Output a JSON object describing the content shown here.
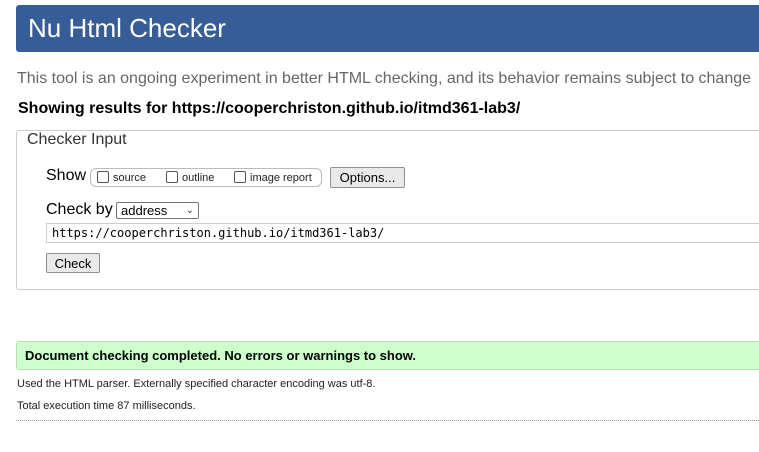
{
  "header": {
    "title": "Nu Html Checker",
    "color": "#365d95"
  },
  "intro": "This tool is an ongoing experiment in better HTML checking, and its behavior remains subject to change",
  "showing": {
    "prefix": "Showing results for ",
    "url": "https://cooperchriston.github.io/itmd361-lab3/"
  },
  "checker_input": {
    "legend": "Checker Input",
    "show_label": "Show",
    "options": [
      {
        "label": "source",
        "checked": false
      },
      {
        "label": "outline",
        "checked": false
      },
      {
        "label": "image report",
        "checked": false
      }
    ],
    "options_button": "Options...",
    "check_by_label": "Check by",
    "check_by_selected": "address",
    "url_value": "https://cooperchriston.github.io/itmd361-lab3/",
    "check_button": "Check"
  },
  "result": {
    "message": "Document checking completed. No errors or warnings to show.",
    "color": "#ccffcc"
  },
  "details": {
    "parser": "Used the HTML parser. Externally specified character encoding was utf-8.",
    "time": "Total execution time 87 milliseconds."
  }
}
